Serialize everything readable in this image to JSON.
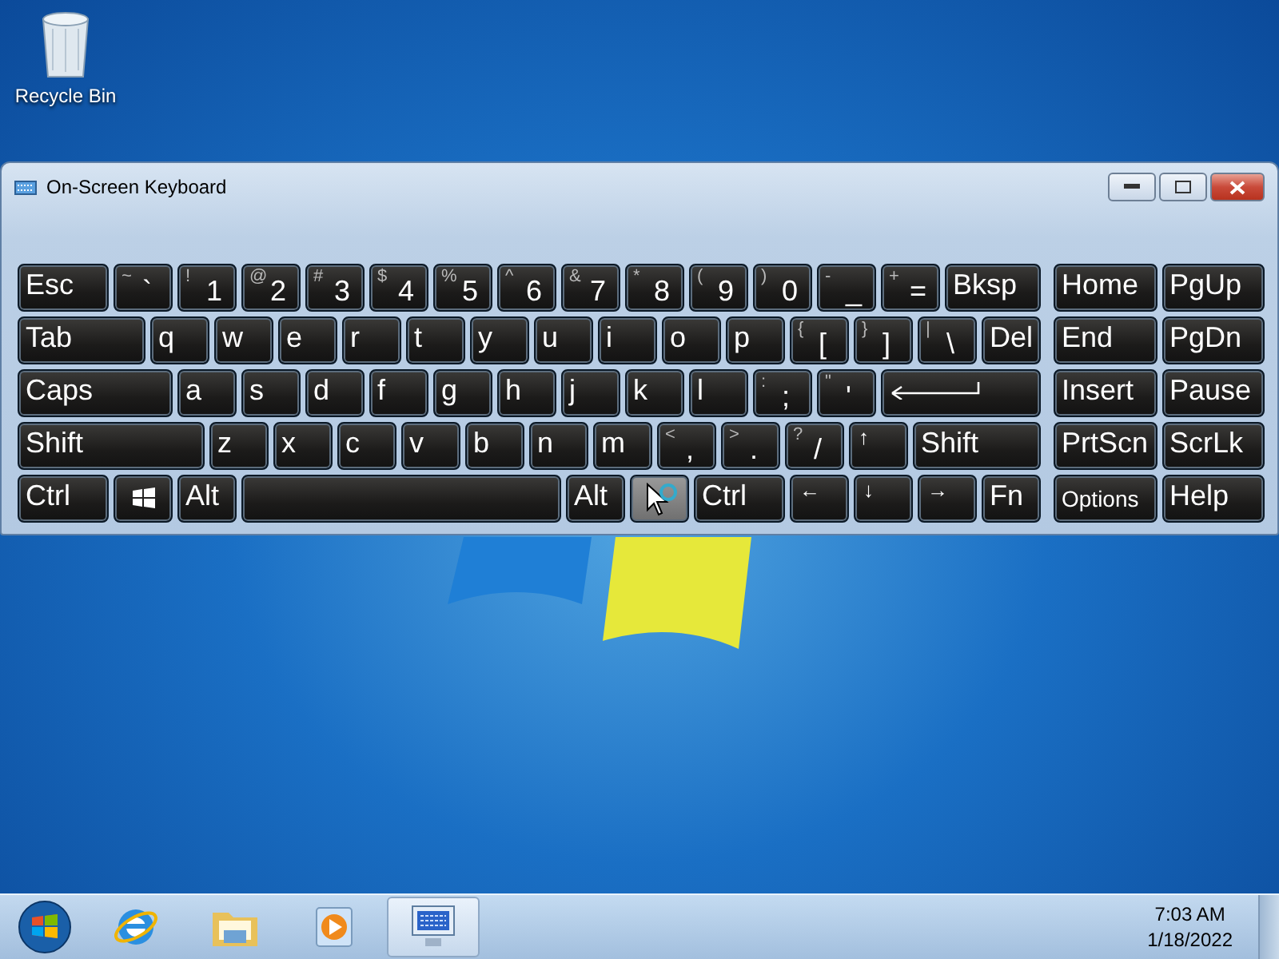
{
  "desktop": {
    "icons": [
      {
        "label": "Recycle Bin"
      }
    ]
  },
  "window": {
    "title": "On-Screen Keyboard",
    "main_rows": [
      [
        {
          "kind": "text",
          "label": "Esc"
        },
        {
          "kind": "char",
          "shift": "~",
          "label": "`"
        },
        {
          "kind": "char",
          "shift": "!",
          "label": "1"
        },
        {
          "kind": "char",
          "shift": "@",
          "label": "2"
        },
        {
          "kind": "char",
          "shift": "#",
          "label": "3"
        },
        {
          "kind": "char",
          "shift": "$",
          "label": "4"
        },
        {
          "kind": "char",
          "shift": "%",
          "label": "5"
        },
        {
          "kind": "char",
          "shift": "^",
          "label": "6"
        },
        {
          "kind": "char",
          "shift": "&",
          "label": "7"
        },
        {
          "kind": "char",
          "shift": "*",
          "label": "8"
        },
        {
          "kind": "char",
          "shift": "(",
          "label": "9"
        },
        {
          "kind": "char",
          "shift": ")",
          "label": "0"
        },
        {
          "kind": "char",
          "shift": "-",
          "label": "_"
        },
        {
          "kind": "char",
          "shift": "+",
          "label": "="
        },
        {
          "kind": "text",
          "label": "Bksp"
        }
      ],
      [
        {
          "kind": "text",
          "label": "Tab"
        },
        {
          "kind": "text",
          "label": "q"
        },
        {
          "kind": "text",
          "label": "w"
        },
        {
          "kind": "text",
          "label": "e"
        },
        {
          "kind": "text",
          "label": "r"
        },
        {
          "kind": "text",
          "label": "t"
        },
        {
          "kind": "text",
          "label": "y"
        },
        {
          "kind": "text",
          "label": "u"
        },
        {
          "kind": "text",
          "label": "i"
        },
        {
          "kind": "text",
          "label": "o"
        },
        {
          "kind": "text",
          "label": "p"
        },
        {
          "kind": "char",
          "shift": "{",
          "label": "["
        },
        {
          "kind": "char",
          "shift": "}",
          "label": "]"
        },
        {
          "kind": "char",
          "shift": "|",
          "label": "\\"
        },
        {
          "kind": "text",
          "label": "Del"
        }
      ],
      [
        {
          "kind": "text",
          "label": "Caps"
        },
        {
          "kind": "text",
          "label": "a"
        },
        {
          "kind": "text",
          "label": "s"
        },
        {
          "kind": "text",
          "label": "d"
        },
        {
          "kind": "text",
          "label": "f"
        },
        {
          "kind": "text",
          "label": "g"
        },
        {
          "kind": "text",
          "label": "h"
        },
        {
          "kind": "text",
          "label": "j"
        },
        {
          "kind": "text",
          "label": "k"
        },
        {
          "kind": "text",
          "label": "l"
        },
        {
          "kind": "char",
          "shift": ":",
          "label": ";"
        },
        {
          "kind": "char",
          "shift": "\"",
          "label": "'"
        },
        {
          "kind": "enter"
        }
      ],
      [
        {
          "kind": "text",
          "label": "Shift"
        },
        {
          "kind": "text",
          "label": "z"
        },
        {
          "kind": "text",
          "label": "x"
        },
        {
          "kind": "text",
          "label": "c"
        },
        {
          "kind": "text",
          "label": "v"
        },
        {
          "kind": "text",
          "label": "b"
        },
        {
          "kind": "text",
          "label": "n"
        },
        {
          "kind": "text",
          "label": "m"
        },
        {
          "kind": "char",
          "shift": "<",
          "label": ","
        },
        {
          "kind": "char",
          "shift": ">",
          "label": "."
        },
        {
          "kind": "char",
          "shift": "?",
          "label": "/"
        },
        {
          "kind": "arrow",
          "label": "↑"
        },
        {
          "kind": "text",
          "label": "Shift"
        }
      ],
      [
        {
          "kind": "text",
          "label": "Ctrl"
        },
        {
          "kind": "windows"
        },
        {
          "kind": "text",
          "label": "Alt"
        },
        {
          "kind": "space"
        },
        {
          "kind": "text",
          "label": "Alt"
        },
        {
          "kind": "covered",
          "hovered": true
        },
        {
          "kind": "text",
          "label": "Ctrl"
        },
        {
          "kind": "arrow",
          "label": "←"
        },
        {
          "kind": "arrow",
          "label": "↓"
        },
        {
          "kind": "arrow",
          "label": "→"
        },
        {
          "kind": "text",
          "label": "Fn"
        }
      ]
    ],
    "nav_rows": [
      [
        {
          "kind": "text",
          "label": "Home"
        },
        {
          "kind": "text",
          "label": "PgUp"
        }
      ],
      [
        {
          "kind": "text",
          "label": "End"
        },
        {
          "kind": "text",
          "label": "PgDn"
        }
      ],
      [
        {
          "kind": "text",
          "label": "Insert"
        },
        {
          "kind": "text",
          "label": "Pause"
        }
      ],
      [
        {
          "kind": "text",
          "label": "PrtScn"
        },
        {
          "kind": "text",
          "label": "ScrLk"
        }
      ],
      [
        {
          "kind": "small",
          "label": "Options"
        },
        {
          "kind": "text",
          "label": "Help"
        }
      ]
    ]
  },
  "taskbar": {
    "items": [
      {
        "kind": "start",
        "selected": false
      },
      {
        "kind": "browser",
        "selected": false
      },
      {
        "kind": "folder",
        "selected": false
      },
      {
        "kind": "media",
        "selected": false
      },
      {
        "kind": "keyboard",
        "selected": true
      }
    ],
    "clock": {
      "time": "7:03 AM",
      "date": "1/18/2022"
    }
  }
}
